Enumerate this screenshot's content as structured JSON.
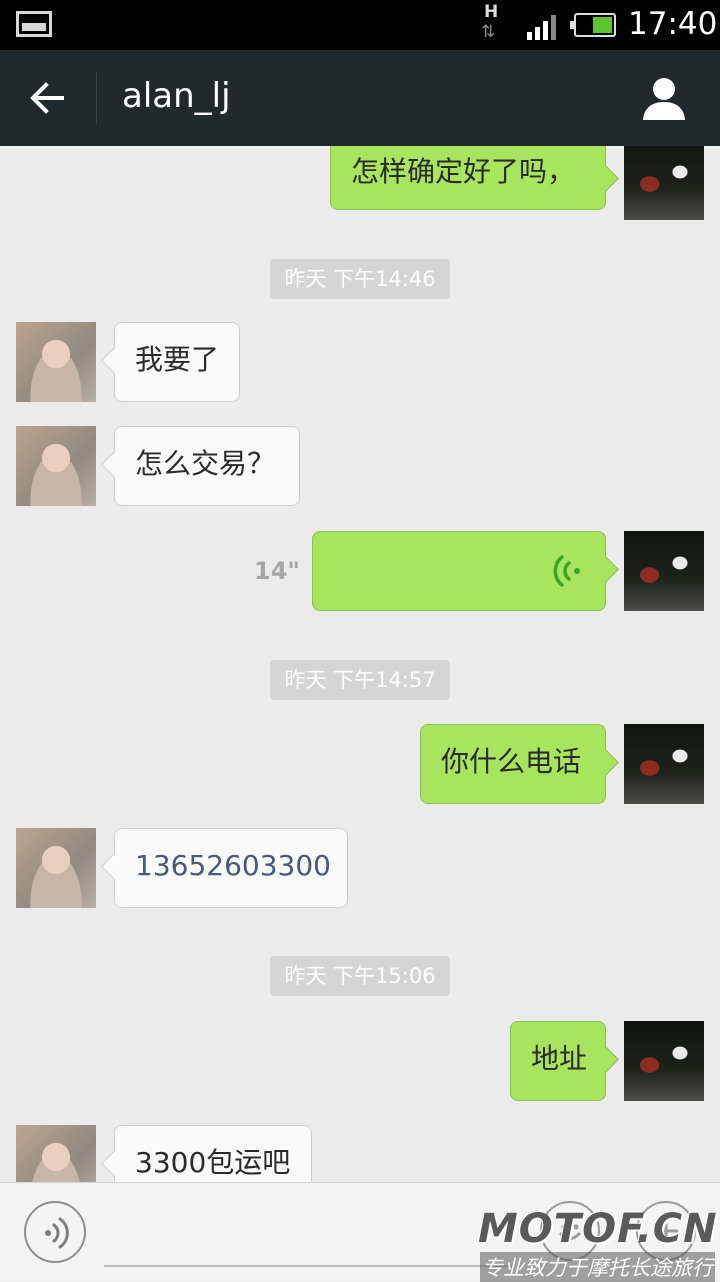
{
  "status_bar": {
    "network_type": "H",
    "time": "17:40",
    "battery_percent": 55
  },
  "header": {
    "title": "alan_lj",
    "back_icon": "arrow-left-icon",
    "profile_icon": "person-icon"
  },
  "messages": [
    {
      "type": "text",
      "sender": "me",
      "text": "怎样确定好了吗，"
    },
    {
      "type": "timestamp",
      "text": "昨天 下午14:46"
    },
    {
      "type": "text",
      "sender": "them",
      "text": "我要了"
    },
    {
      "type": "text",
      "sender": "them",
      "text": "怎么交易？"
    },
    {
      "type": "voice",
      "sender": "me",
      "duration": "14\""
    },
    {
      "type": "timestamp",
      "text": "昨天 下午14:57"
    },
    {
      "type": "text",
      "sender": "me",
      "text": "你什么电话"
    },
    {
      "type": "text",
      "sender": "them",
      "text": "13652603300",
      "is_phone_link": true
    },
    {
      "type": "timestamp",
      "text": "昨天 下午15:06"
    },
    {
      "type": "text",
      "sender": "me",
      "text": "地址"
    },
    {
      "type": "text",
      "sender": "them",
      "text": "3300包运吧"
    }
  ],
  "input_bar": {
    "voice_toggle_icon": "voice-icon",
    "emoji_icon": "smiley-icon",
    "more_icon": "plus-icon"
  },
  "watermark": {
    "title": "MOTOF.CN",
    "subtitle": "专业致力于摩托长途旅行"
  },
  "colors": {
    "header_bg": "#22292c",
    "chat_bg": "#ebebeb",
    "my_bubble": "#a8e45e",
    "their_bubble": "#fafafa",
    "timestamp_bg": "#d5d5d5",
    "voice_wave": "#3aa52a"
  }
}
